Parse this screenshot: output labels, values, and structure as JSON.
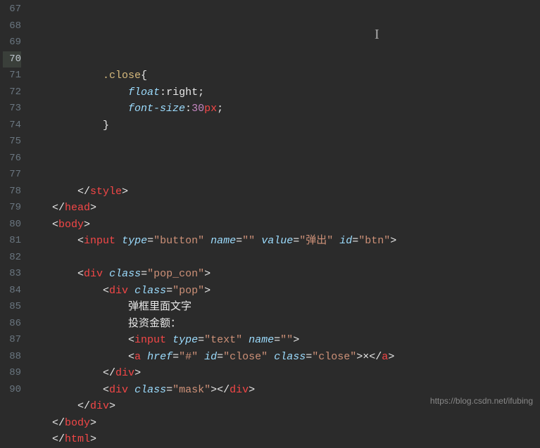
{
  "lines": {
    "67": "",
    "68": {
      "indent": "            ",
      "selector": ".close",
      "brace": "{"
    },
    "69": {
      "indent": "                ",
      "prop": "float",
      "val": "right",
      "semi": ";"
    },
    "70": {
      "indent": "                ",
      "prop": "font-size",
      "num": "30",
      "unit": "px",
      "semi": ";"
    },
    "71": {
      "indent": "            ",
      "brace": "}"
    },
    "72": "",
    "73": "",
    "74": "",
    "75": {
      "indent": "        ",
      "close_tag": "style"
    },
    "76": {
      "indent": "    ",
      "close_tag": "head"
    },
    "77": {
      "indent": "    ",
      "open_tag": "body"
    },
    "78": {
      "indent": "        ",
      "open_tag": "input",
      "attrs": [
        [
          "type",
          "\"button\""
        ],
        [
          "name",
          "\"\""
        ],
        [
          "value",
          "\"弹出\""
        ],
        [
          "id",
          "\"btn\""
        ]
      ],
      "self_close": true
    },
    "79": "",
    "80": {
      "indent": "        ",
      "open_tag": "div",
      "attrs": [
        [
          "class",
          "\"pop_con\""
        ]
      ]
    },
    "81": {
      "indent": "            ",
      "open_tag": "div",
      "attrs": [
        [
          "class",
          "\"pop\""
        ]
      ]
    },
    "82": {
      "indent": "                ",
      "text": "弹框里面文字"
    },
    "83": {
      "indent": "                ",
      "text": "投资金额："
    },
    "84": {
      "indent": "                ",
      "open_tag": "input",
      "attrs": [
        [
          "type",
          "\"text\""
        ],
        [
          "name",
          "\"\""
        ]
      ],
      "self_close": true
    },
    "85": {
      "indent": "                ",
      "open_tag": "a",
      "attrs": [
        [
          "href",
          "\"#\""
        ],
        [
          "id",
          "\"close\""
        ],
        [
          "class",
          "\"close\""
        ]
      ],
      "inner": "×",
      "close_inline": "a"
    },
    "86": {
      "indent": "            ",
      "close_tag": "div"
    },
    "87": {
      "indent": "            ",
      "open_tag": "div",
      "attrs": [
        [
          "class",
          "\"mask\""
        ]
      ],
      "close_inline": "div"
    },
    "88": {
      "indent": "        ",
      "close_tag": "div"
    },
    "89": {
      "indent": "    ",
      "close_tag": "body"
    },
    "90": {
      "indent": "    ",
      "close_tag": "html"
    }
  },
  "line_numbers": [
    "67",
    "68",
    "69",
    "70",
    "71",
    "72",
    "73",
    "74",
    "75",
    "76",
    "77",
    "78",
    "79",
    "80",
    "81",
    "82",
    "83",
    "84",
    "85",
    "86",
    "87",
    "88",
    "89",
    "90"
  ],
  "active_line": "70",
  "watermark": "https://blog.csdn.net/ifubing",
  "cursor_glyph": "I"
}
